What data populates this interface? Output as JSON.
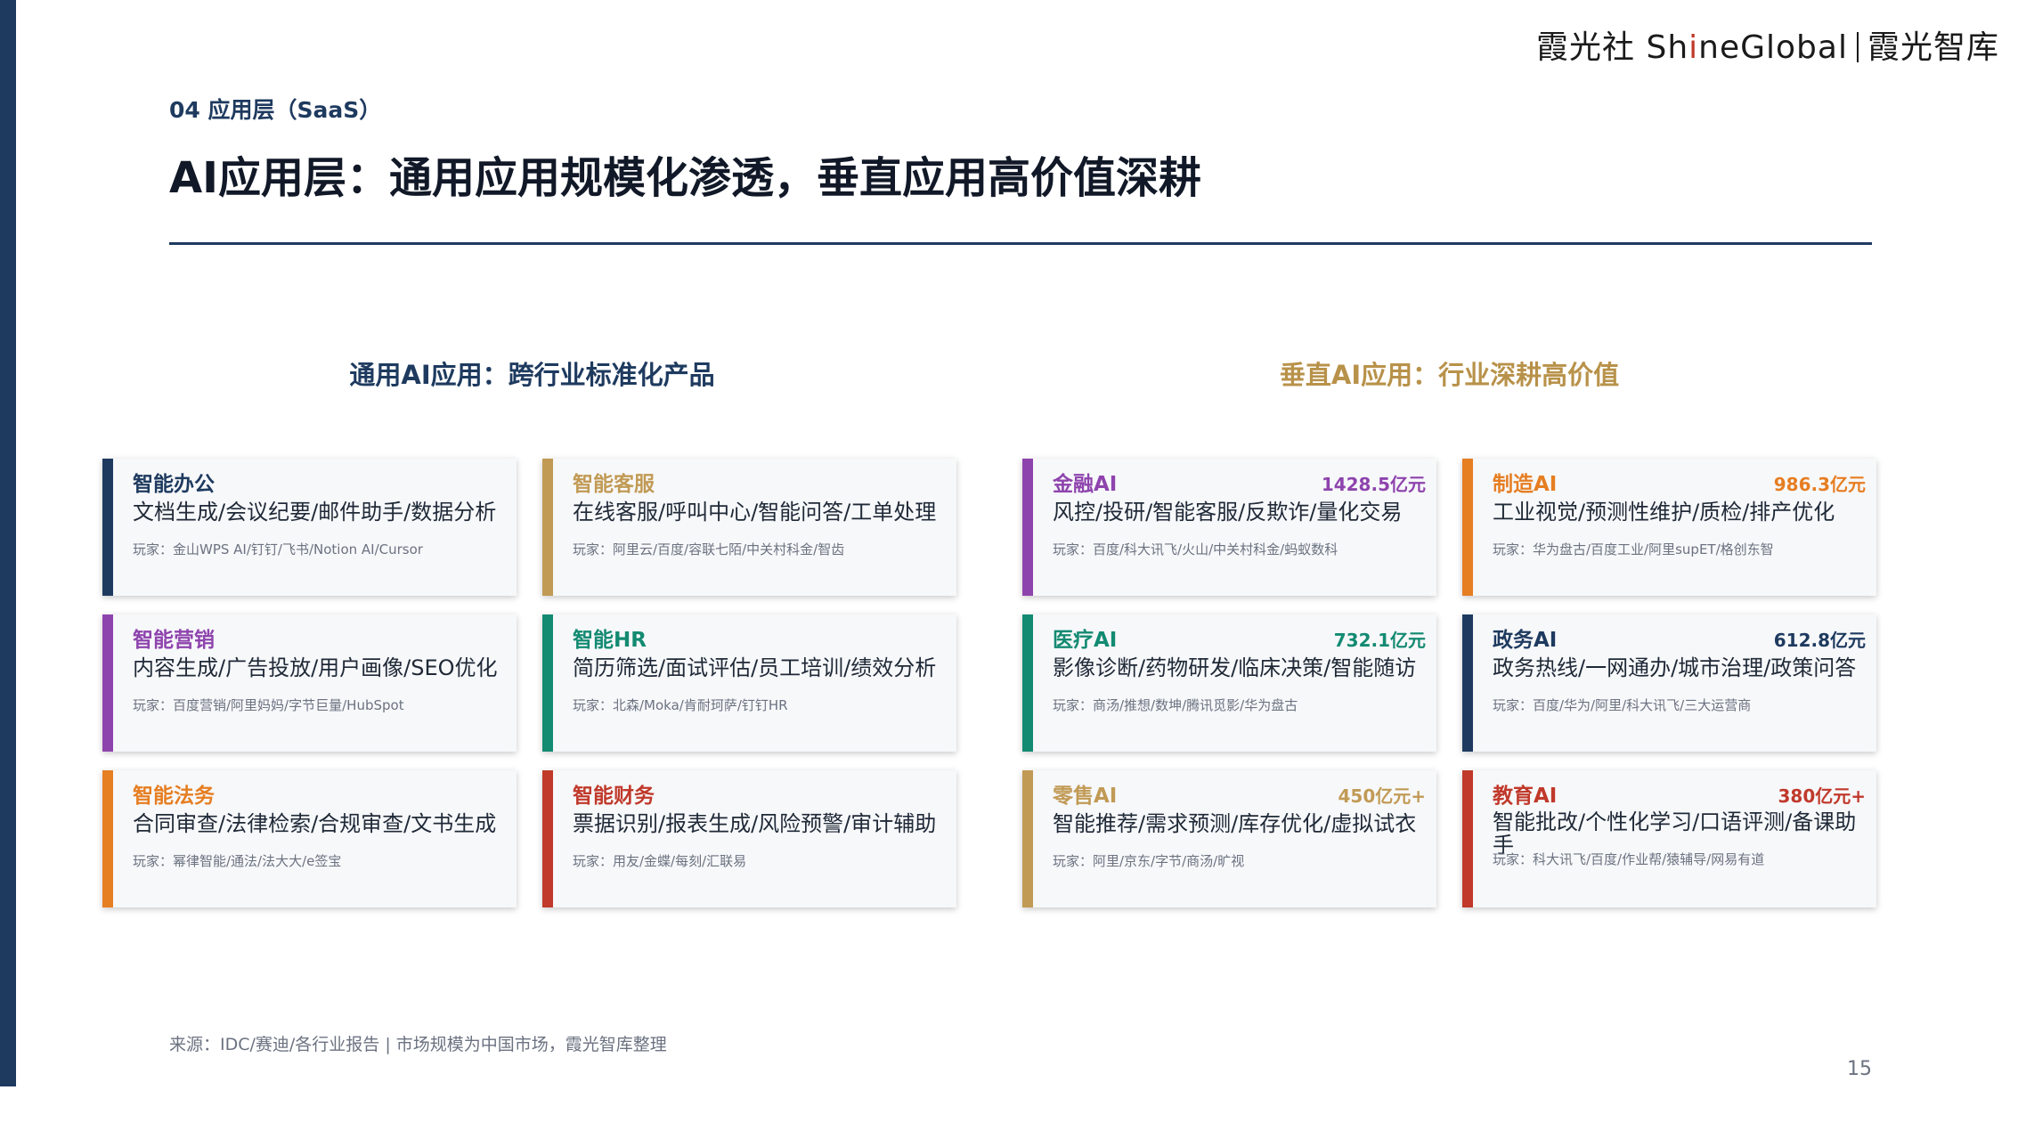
{
  "brand": {
    "part1": "霞光社 Sh",
    "highlight": "i",
    "part2": "neGlobal",
    "part3": "霞光智库"
  },
  "section_tag": "04 应用层（SaaS）",
  "title": "AI应用层：通用应用规模化渗透，垂直应用高价值深耕",
  "left_heading": "通用AI应用：跨行业标准化产品",
  "right_heading": "垂直AI应用：行业深耕高价值",
  "general_apps": [
    {
      "name": "智能办公",
      "desc": "文档生成/会议纪要/邮件助手/数据分析",
      "players": "玩家：金山WPS AI/钉钉/飞书/Notion AI/Cursor",
      "color": "#1e3a5f"
    },
    {
      "name": "智能客服",
      "desc": "在线客服/呼叫中心/智能问答/工单处理",
      "players": "玩家：阿里云/百度/容联七陌/中关村科金/智齿",
      "color": "#c19a55"
    },
    {
      "name": "智能营销",
      "desc": "内容生成/广告投放/用户画像/SEO优化",
      "players": "玩家：百度营销/阿里妈妈/字节巨量/HubSpot",
      "color": "#8e44ad"
    },
    {
      "name": "智能HR",
      "desc": "简历筛选/面试评估/员工培训/绩效分析",
      "players": "玩家：北森/Moka/肯耐珂萨/钉钉HR",
      "color": "#138a72"
    },
    {
      "name": "智能法务",
      "desc": "合同审查/法律检索/合规审查/文书生成",
      "players": "玩家：幂律智能/通法/法大大/e签宝",
      "color": "#e67e22"
    },
    {
      "name": "智能财务",
      "desc": "票据识别/报表生成/风险预警/审计辅助",
      "players": "玩家：用友/金蝶/每刻/汇联易",
      "color": "#c0392b"
    }
  ],
  "vertical_apps": [
    {
      "name": "金融AI",
      "size": "1428.5亿元",
      "desc": "风控/投研/智能客服/反欺诈/量化交易",
      "players": "玩家：百度/科大讯飞/火山/中关村科金/蚂蚁数科",
      "color": "#8e44ad"
    },
    {
      "name": "制造AI",
      "size": "986.3亿元",
      "desc": "工业视觉/预测性维护/质检/排产优化",
      "players": "玩家：华为盘古/百度工业/阿里supET/格创东智",
      "color": "#e67e22"
    },
    {
      "name": "医疗AI",
      "size": "732.1亿元",
      "desc": "影像诊断/药物研发/临床决策/智能随访",
      "players": "玩家：商汤/推想/数坤/腾讯觅影/华为盘古",
      "color": "#138a72"
    },
    {
      "name": "政务AI",
      "size": "612.8亿元",
      "desc": "政务热线/一网通办/城市治理/政策问答",
      "players": "玩家：百度/华为/阿里/科大讯飞/三大运营商",
      "color": "#1e3a5f"
    },
    {
      "name": "零售AI",
      "size": "450亿元+",
      "desc": "智能推荐/需求预测/库存优化/虚拟试衣",
      "players": "玩家：阿里/京东/字节/商汤/旷视",
      "color": "#c19a55"
    },
    {
      "name": "教育AI",
      "size": "380亿元+",
      "desc": "智能批改/个性化学习/口语评测/备课助手",
      "players": "玩家：科大讯飞/百度/作业帮/猿辅导/网易有道",
      "color": "#c0392b"
    }
  ],
  "footer": "来源：IDC/赛迪/各行业报告 | 市场规模为中国市场，霞光智库整理",
  "page_number": "15"
}
